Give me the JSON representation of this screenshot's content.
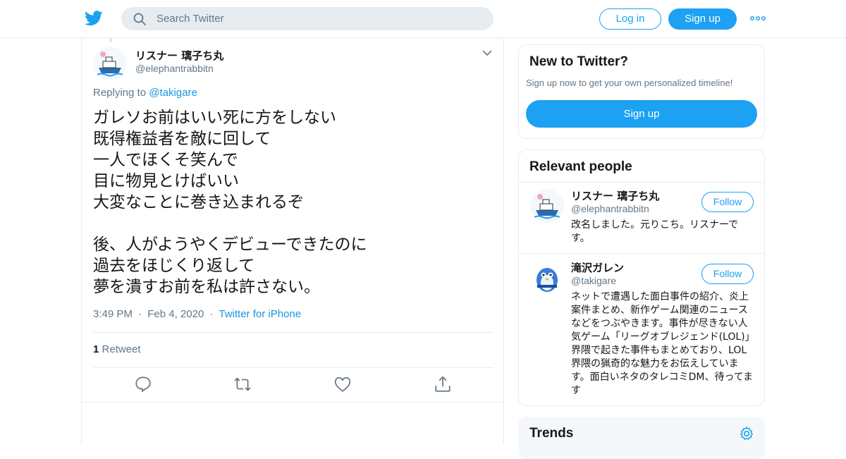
{
  "header": {
    "logo_icon": "twitter-bird-icon",
    "search_placeholder": "Search Twitter",
    "login_label": "Log in",
    "signup_label": "Sign up",
    "more_icon": "more-dots-icon",
    "accent": "#1da1f2"
  },
  "tweet": {
    "author_name": "リスナー 璃子ち丸",
    "author_handle": "@elephantrabbitn",
    "replying_prefix": "Replying to",
    "replying_to": "@takigare",
    "text": "ガレソお前はいい死に方をしない\n既得権益者を敵に回して\n一人でほくそ笑んで\n目に物見とけばいい\n大変なことに巻き込まれるぞ\n\n後、人がようやくデビューできたのに\n過去をほじくり返して\n夢を潰すお前を私は許さない。",
    "time": "3:49 PM",
    "date": "Feb 4, 2020",
    "separator": "·",
    "source": "Twitter for iPhone",
    "retweet_count": "1",
    "retweet_label": "Retweet",
    "actions": [
      "reply-icon",
      "retweet-icon",
      "like-icon",
      "share-icon"
    ]
  },
  "sidebar": {
    "new_to_twitter": {
      "title": "New to Twitter?",
      "subtitle": "Sign up now to get your own personalized timeline!",
      "button": "Sign up"
    },
    "relevant_people": {
      "title": "Relevant people",
      "people": [
        {
          "name": "リスナー 璃子ち丸",
          "handle": "@elephantrabbitn",
          "follow": "Follow",
          "bio": "改名しました。元りこち。リスナーです。"
        },
        {
          "name": "滝沢ガレン",
          "handle": "@takigare",
          "follow": "Follow",
          "bio": "ネットで遭遇した面白事件の紹介、炎上案件まとめ、新作ゲーム関連のニュースなどをつぶやきます。事件が尽きない人気ゲーム「リーグオブレジェンド(LOL)」界隈で起きた事件もまとめており、LOL界隈の猟奇的な魅力をお伝えしています。面白いネタのタレコミDM、待ってます"
        }
      ]
    },
    "trends": {
      "title": "Trends",
      "settings_icon": "gear-icon"
    }
  }
}
